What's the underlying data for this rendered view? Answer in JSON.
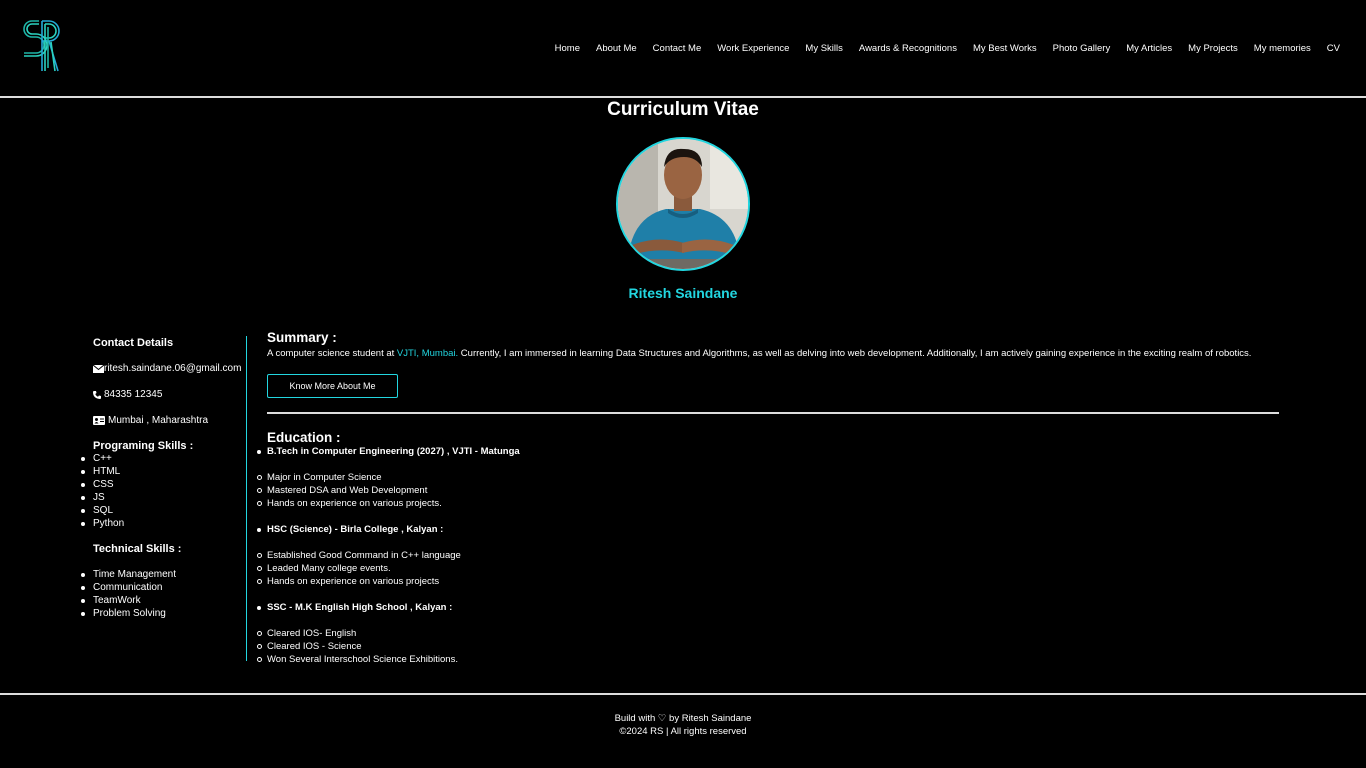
{
  "nav": {
    "items": [
      "Home",
      "About Me",
      "Contact Me",
      "Work Experience",
      "My Skills",
      "Awards & Recognitions",
      "My Best Works",
      "Photo Gallery",
      "My Articles",
      "My Projects",
      "My memories",
      "CV"
    ]
  },
  "page": {
    "title": "Curriculum Vitae"
  },
  "profile": {
    "name": "Ritesh Saindane"
  },
  "sidebar": {
    "contact_heading": "Contact Details",
    "email": "ritesh.saindane.06@gmail.com",
    "phone": "84335 12345",
    "location": "Mumbai , Maharashtra",
    "programming_heading": "Programing Skills :",
    "programming_skills": [
      "C++",
      "HTML",
      "CSS",
      "JS",
      "SQL",
      "Python"
    ],
    "technical_heading": "Technical Skills :",
    "technical_skills": [
      "Time Management",
      "Communication",
      "TeamWork",
      "Problem Solving"
    ]
  },
  "summary": {
    "heading": "Summary :",
    "text_before": "A computer science student at ",
    "highlight": "VJTI, Mumbai.",
    "text_after": " Currently, I am immersed in learning Data Structures and Algorithms, as well as delving into web development. Additionally, I am actively gaining experience in the exciting realm of robotics.",
    "button_label": "Know More About Me"
  },
  "education": {
    "heading": "Education :",
    "entries": [
      {
        "title": "B.Tech in Computer Engineering (2027) , VJTI - Matunga",
        "points": [
          "Major in Computer Science",
          "Mastered DSA and Web Development",
          "Hands on experience on various projects."
        ]
      },
      {
        "title": "HSC (Science) - Birla College , Kalyan :",
        "points": [
          "Established Good Command in C++ language",
          "Leaded Many college events.",
          "Hands on experience on various projects"
        ]
      },
      {
        "title": "SSC - M.K English High School , Kalyan :",
        "points": [
          "Cleared IOS- English",
          "Cleared IOS - Science",
          "Won Several Interschool Science Exhibitions."
        ]
      }
    ]
  },
  "footer": {
    "line1": "Build with ♡ by Ritesh Saindane",
    "line2": "©2024 RS | All rights reserved"
  },
  "colors": {
    "accent": "#22d6e0",
    "background": "#000000",
    "text": "#ffffff",
    "divider": "#dddddd"
  }
}
